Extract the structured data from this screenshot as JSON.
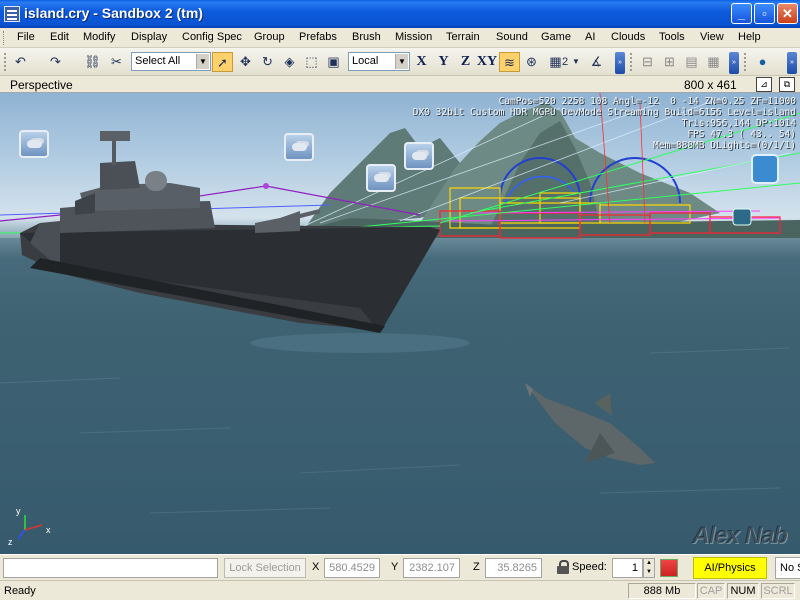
{
  "window": {
    "title": "island.cry - Sandbox 2 (tm)",
    "buttons": {
      "minimize": "_",
      "maximize": "▫",
      "close": "✕"
    }
  },
  "menu": [
    "File",
    "Edit",
    "Modify",
    "Display",
    "Config Spec",
    "Group",
    "Prefabs",
    "Brush",
    "Mission",
    "Terrain",
    "Sound",
    "Game",
    "AI",
    "Clouds",
    "Tools",
    "View",
    "Help"
  ],
  "toolbar": {
    "selection_filter": "Select All",
    "coord_system": "Local",
    "axis_buttons": [
      "X",
      "Y",
      "Z",
      "XY"
    ],
    "grid_value": "2"
  },
  "viewport": {
    "title": "Perspective",
    "resolution": "800 x 461",
    "hud_lines": [
      "CamPos=520 2258 108 Angl=-12  0 -14 ZN=0.25 ZF=11000",
      "DX9 32bit Custom HDR MGPU DevMode Streaming Build=6156 Level=island",
      "Tris:956,144 DP:1014",
      "FPS 47.3 ( 43.. 54)",
      "Mem=888MB DLights=(0/1/1)"
    ],
    "watermark": "Alex Nab",
    "axis_labels": {
      "x": "x",
      "y": "y",
      "z": "z"
    }
  },
  "controls": {
    "lock_selection": "Lock Selection",
    "x_label": "X",
    "x_value": "580.4529",
    "y_label": "Y",
    "y_value": "2382.107",
    "z_label": "Z",
    "z_value": "35.8265",
    "speed_label": "Speed:",
    "speed_value": "1",
    "ai_physics": "AI/Physics",
    "snap": "No Snap"
  },
  "status": {
    "text": "Ready",
    "memory": "888 Mb",
    "cap": "CAP",
    "num": "NUM",
    "scrl": "SCRL"
  },
  "colors": {
    "titlebar": "#0a54d3",
    "ai_physics_bg": "#ffff00",
    "active_tool": "#ffd16b"
  }
}
